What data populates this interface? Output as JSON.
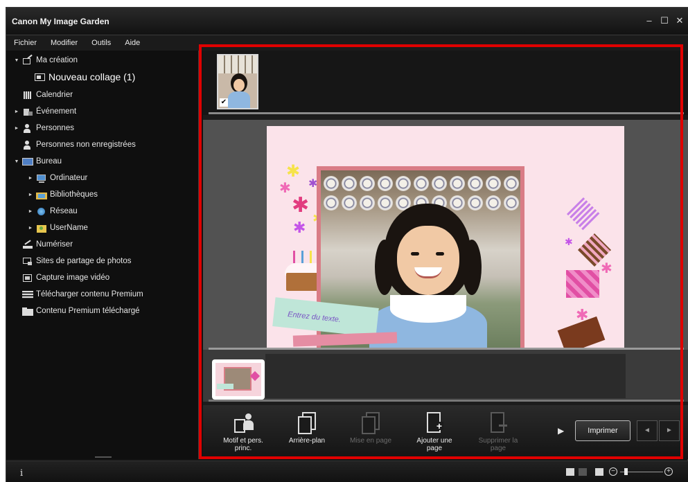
{
  "window": {
    "title": "Canon My Image Garden"
  },
  "menu": [
    "Fichier",
    "Modifier",
    "Outils",
    "Aide"
  ],
  "sidebar": {
    "items": [
      {
        "label": "Ma création",
        "arrow": "▼",
        "icon": "my-art-icon"
      },
      {
        "label": "Nouveau collage (1)",
        "arrow": "",
        "icon": "collage-icon"
      },
      {
        "label": "Calendrier",
        "arrow": "",
        "icon": "calendar-icon"
      },
      {
        "label": "Événement",
        "arrow": "►",
        "icon": "event-icon"
      },
      {
        "label": "Personnes",
        "arrow": "►",
        "icon": "people-icon"
      },
      {
        "label": "Personnes non enregistrées",
        "arrow": "",
        "icon": "unregistered-people-icon"
      },
      {
        "label": "Bureau",
        "arrow": "▼",
        "icon": "desktop-icon"
      },
      {
        "label": "Ordinateur",
        "arrow": "►",
        "icon": "computer-icon"
      },
      {
        "label": "Bibliothèques",
        "arrow": "►",
        "icon": "libraries-icon"
      },
      {
        "label": "Réseau",
        "arrow": "►",
        "icon": "network-icon"
      },
      {
        "label": "UserName",
        "arrow": "►",
        "icon": "user-folder-icon"
      },
      {
        "label": "Numériser",
        "arrow": "",
        "icon": "scan-icon"
      },
      {
        "label": "Sites de partage de photos",
        "arrow": "",
        "icon": "photo-sharing-icon"
      },
      {
        "label": "Capture image vidéo",
        "arrow": "",
        "icon": "video-capture-icon"
      },
      {
        "label": "Télécharger contenu Premium",
        "arrow": "",
        "icon": "download-premium-icon"
      },
      {
        "label": "Contenu Premium téléchargé",
        "arrow": "",
        "icon": "downloaded-premium-icon"
      }
    ]
  },
  "canvas": {
    "placeholder_text": "Entrez du texte."
  },
  "toolbar": {
    "tools": [
      {
        "label": "Motif et pers. princ.",
        "enabled": true
      },
      {
        "label": "Arrière-plan",
        "enabled": true
      },
      {
        "label": "Mise en page",
        "enabled": false
      },
      {
        "label": "Ajouter une page",
        "enabled": true
      },
      {
        "label": "Supprimer la page",
        "enabled": false
      }
    ],
    "print_label": "Imprimer",
    "prev_icon": "◄",
    "next_icon": "►",
    "more_icon": "▶"
  },
  "status": {
    "info_icon": "i",
    "zoom_minus": "−",
    "zoom_plus": "+"
  },
  "colors": {
    "highlight_frame": "#e00000",
    "background": "#141414"
  }
}
